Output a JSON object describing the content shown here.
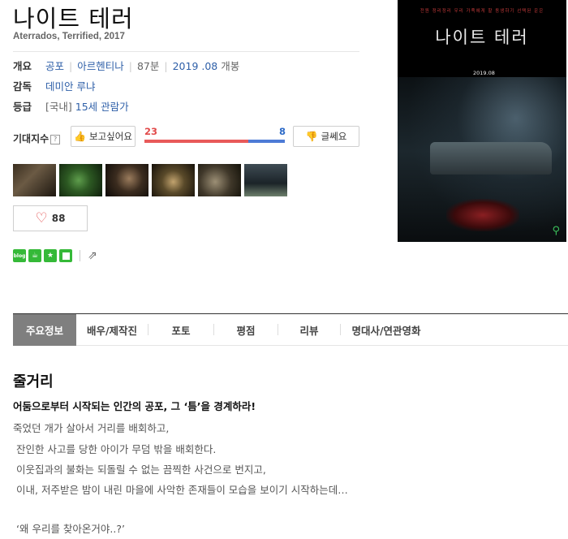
{
  "movie": {
    "title": "나이트 테러",
    "original_title_line": "Aterrados, Terrified, 2017"
  },
  "info": {
    "overview_label": "개요",
    "genre": "공포",
    "country": "아르헨티나",
    "runtime": "87분",
    "release_date": "2019 .08",
    "release_suffix": "개봉",
    "director_label": "감독",
    "director": "데미안 루냐",
    "grade_label": "등급",
    "grade_region": "[국내]",
    "grade": "15세 관람가"
  },
  "expectation": {
    "label": "기대지수",
    "help": "?",
    "want_label": "보고싶어요",
    "not_sure_label": "글쎄요",
    "want_count": "23",
    "not_sure_count": "8",
    "want_ratio": 0.74
  },
  "stills": [
    "still-1",
    "still-2",
    "still-3",
    "still-4",
    "still-5",
    "still-6"
  ],
  "like": {
    "count": "88"
  },
  "share": {
    "blog_label": "blog"
  },
  "poster": {
    "tagline": "전원 정리정리 우리 가족에게 할 동생하기 선택된 운은",
    "title": "나이트 테러",
    "date": "2019.08"
  },
  "tabs": [
    {
      "label": "주요정보",
      "active": true
    },
    {
      "label": "배우/제작진",
      "active": false
    },
    {
      "label": "포토",
      "active": false
    },
    {
      "label": "평점",
      "active": false
    },
    {
      "label": "리뷰",
      "active": false
    },
    {
      "label": "명대사/연관영화",
      "active": false
    }
  ],
  "synopsis": {
    "heading": "줄거리",
    "headline": "어둠으로부터 시작되는 인간의 공포, 그 ‘틈’을 경계하라!",
    "lines": [
      "죽었던 개가 살아서 거리를 배회하고,",
      "잔인한 사고를 당한 아이가 무덤 밖을 배회한다.",
      "이웃집과의 불화는 되돌릴 수 없는 끔찍한 사건으로 번지고,",
      "이내, 저주받은 밤이 내린 마을에 사악한 존재들이 모습을 보이기 시작하는데…",
      "‘왜 우리를 찾아온거야..?’"
    ]
  },
  "colors": {
    "link": "#2e5fa8",
    "want": "#e24b4b",
    "not_sure": "#2e6bc8",
    "tab_active_bg": "#7f7f7f",
    "share_green": "#35b938"
  }
}
